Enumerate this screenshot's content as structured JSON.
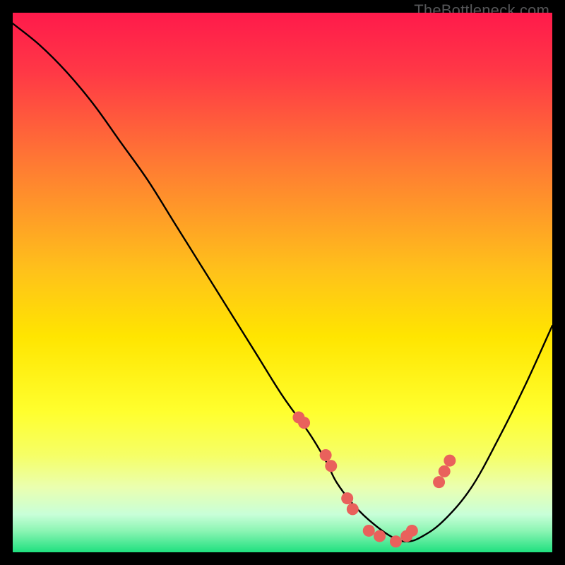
{
  "watermark": "TheBottleneck.com",
  "chart_data": {
    "type": "line",
    "title": "",
    "xlabel": "",
    "ylabel": "",
    "xlim": [
      0,
      100
    ],
    "ylim": [
      0,
      100
    ],
    "background_gradient": {
      "top": "#ff1a4b",
      "upper_mid": "#ff7a33",
      "mid": "#ffd400",
      "lower_mid": "#f5ff4a",
      "near_bottom": "#e6ffce",
      "bottom": "#1fe07f"
    },
    "series": [
      {
        "name": "bottleneck-curve",
        "x": [
          0,
          5,
          10,
          15,
          20,
          25,
          30,
          35,
          40,
          45,
          50,
          55,
          58,
          60,
          63,
          66,
          70,
          73,
          76,
          80,
          85,
          90,
          95,
          100
        ],
        "y": [
          98,
          94,
          89,
          83,
          76,
          69,
          61,
          53,
          45,
          37,
          29,
          22,
          17,
          13,
          9,
          6,
          3,
          2,
          3,
          6,
          12,
          21,
          31,
          42
        ]
      }
    ],
    "highlight_points": {
      "name": "marker-dots",
      "color": "#e9615c",
      "x": [
        53,
        54,
        58,
        59,
        62,
        63,
        66,
        68,
        71,
        73,
        74,
        79,
        80,
        81
      ],
      "y": [
        25,
        24,
        18,
        16,
        10,
        8,
        4,
        3,
        2,
        3,
        4,
        13,
        15,
        17
      ]
    }
  }
}
